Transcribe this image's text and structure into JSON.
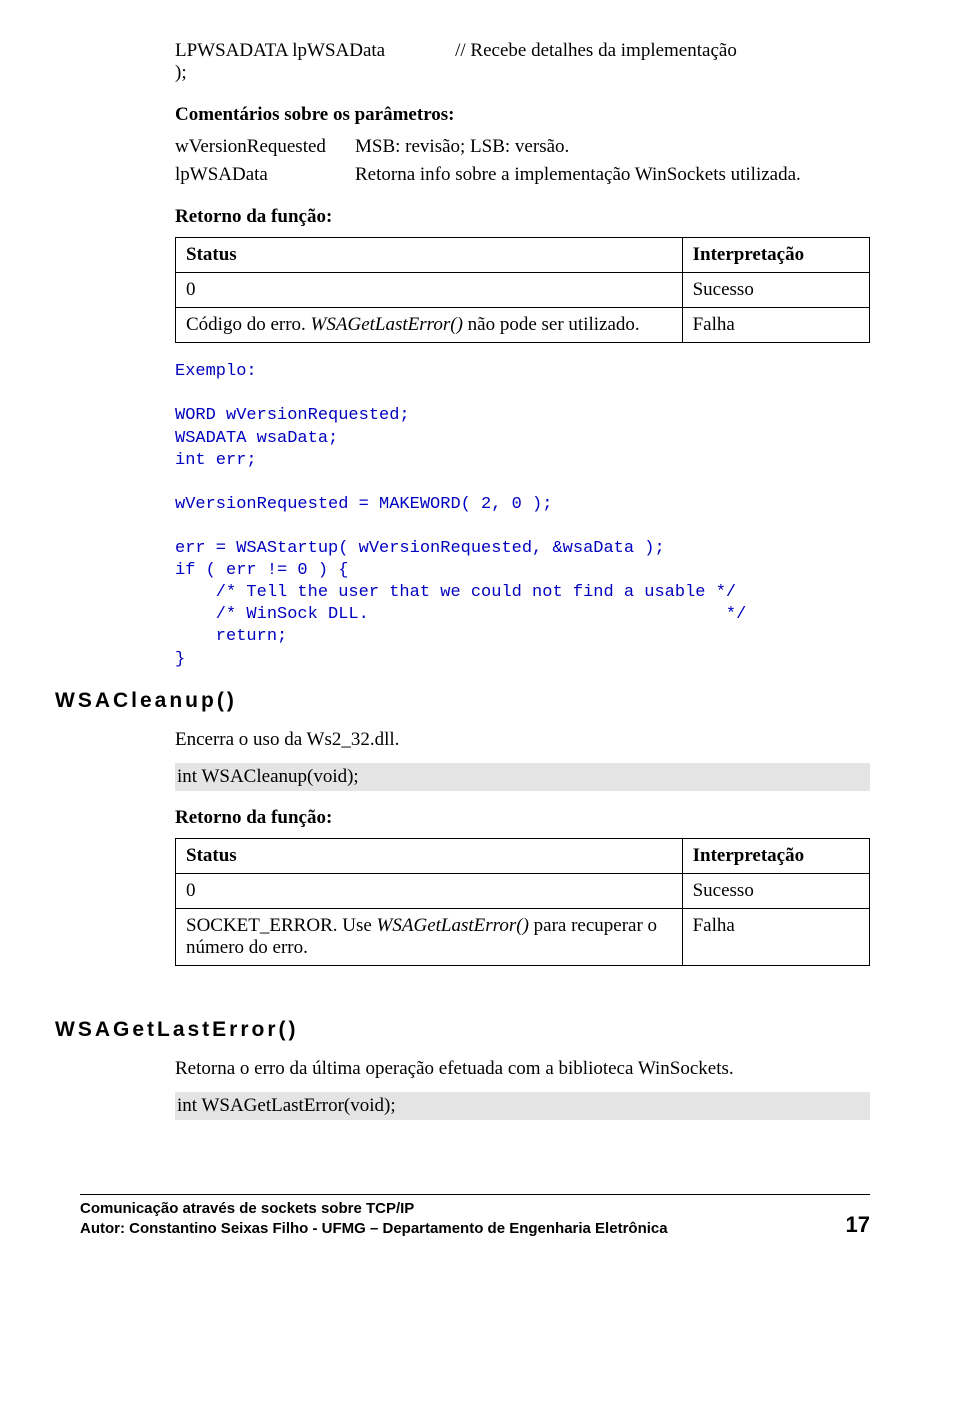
{
  "top": {
    "sig_left": "LPWSADATA lpWSAData\n);",
    "sig_right": "// Recebe detalhes da implementação",
    "comments_heading": "Comentários sobre os parâmetros:",
    "params": [
      {
        "name": "wVersionRequested",
        "desc": "MSB: revisão; LSB: versão."
      },
      {
        "name": "lpWSAData",
        "desc": "Retorna info sobre a implementação WinSockets utilizada."
      }
    ],
    "return_heading": "Retorno da função:"
  },
  "table1": {
    "h1": "Status",
    "h2": "Interpretação",
    "r1c1": "0",
    "r1c2": "Sucesso",
    "r2c1a": "Código do erro. ",
    "r2c1b": "WSAGetLastError()",
    "r2c1c": " não pode ser utilizado.",
    "r2c2": "Falha"
  },
  "code1": "Exemplo:\n\nWORD wVersionRequested;\nWSADATA wsaData;\nint err;\n\nwVersionRequested = MAKEWORD( 2, 0 );\n\nerr = WSAStartup( wVersionRequested, &wsaData );\nif ( err != 0 ) {\n    /* Tell the user that we could not find a usable */\n    /* WinSock DLL.                                   */\n    return;\n}",
  "wsacleanup": {
    "heading": "WSACleanup()",
    "desc": "Encerra o uso da Ws2_32.dll.",
    "proto": "int WSACleanup(void);",
    "return_heading": "Retorno da função:"
  },
  "table2": {
    "h1": "Status",
    "h2": "Interpretação",
    "r1c1": "0",
    "r1c2": "Sucesso",
    "r2c1a": "SOCKET_ERROR. Use ",
    "r2c1b": "WSAGetLastError()",
    "r2c1c": " para recuperar o número do erro.",
    "r2c2": "Falha"
  },
  "wsagle": {
    "heading": "WSAGetLastError()",
    "desc": "Retorna o erro da última operação efetuada com a biblioteca WinSockets.",
    "proto": "int WSAGetLastError(void);"
  },
  "footer": {
    "line1": "Comunicação através de sockets sobre TCP/IP",
    "line2": "Autor: Constantino Seixas Filho - UFMG – Departamento de Engenharia Eletrônica",
    "page": "17"
  }
}
